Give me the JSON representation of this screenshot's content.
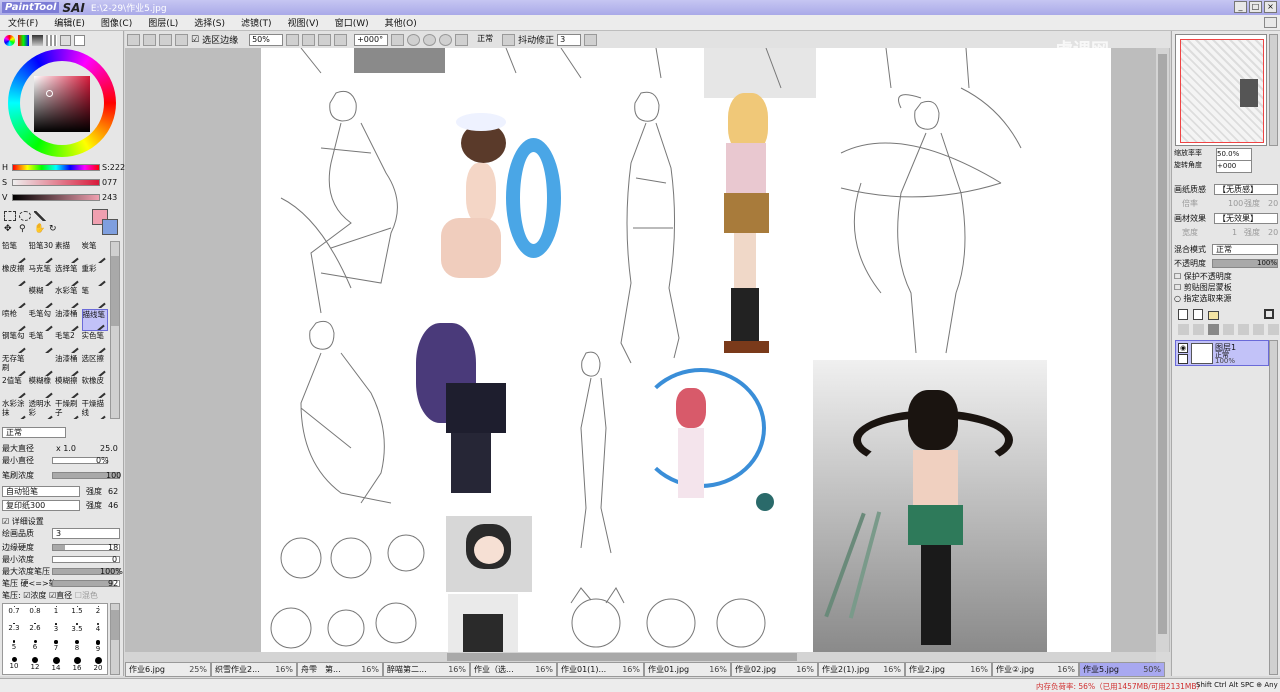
{
  "titlebar": {
    "logo": "PaintTool",
    "logo_sai": "SAI",
    "path": "E:\\2-29\\作业5.jpg",
    "min": "_",
    "max": "□",
    "close": "×"
  },
  "menu": [
    "文件(F)",
    "编辑(E)",
    "图像(C)",
    "图层(L)",
    "选择(S)",
    "滤镜(T)",
    "视图(V)",
    "窗口(W)",
    "其他(O)"
  ],
  "toolbar": {
    "selection_edge_label": "选区边缘",
    "zoom": "50%",
    "angle": "+000°",
    "blend": "正常",
    "stabilizer_label": "抖动修正",
    "stabilizer": "3"
  },
  "watermark": "虎课网",
  "color": {
    "h_label": "H",
    "h_value": "S:222",
    "s_label": "S",
    "s_value": "077",
    "v_label": "V",
    "v_value": "243",
    "primary": "#f0a0b0",
    "secondary": "#7f9fdf"
  },
  "tools": [
    {
      "label": "铅笔"
    },
    {
      "label": "铅笔30"
    },
    {
      "label": "素描"
    },
    {
      "label": "炭笔"
    },
    {
      "label": "橡皮擦"
    },
    {
      "label": "马克笔"
    },
    {
      "label": "选择笔"
    },
    {
      "label": "重彩"
    },
    {
      "label": ""
    },
    {
      "label": "模糊"
    },
    {
      "label": "水彩笔"
    },
    {
      "label": "笔"
    },
    {
      "label": "喷枪"
    },
    {
      "label": "毛笔勾"
    },
    {
      "label": "油漆桶"
    },
    {
      "label": "描线笔"
    },
    {
      "label": "钢笔勾"
    },
    {
      "label": "毛笔"
    },
    {
      "label": "毛笔2"
    },
    {
      "label": "实色笔"
    },
    {
      "label": "无存笔刷"
    },
    {
      "label": ""
    },
    {
      "label": "油漆桶"
    },
    {
      "label": "选区擦"
    },
    {
      "label": "2值笔"
    },
    {
      "label": "模糊橡"
    },
    {
      "label": "模糊擦"
    },
    {
      "label": "软橡皮"
    },
    {
      "label": "水彩涂抹"
    },
    {
      "label": "透明水彩"
    },
    {
      "label": "干燥刷子"
    },
    {
      "label": "干燥描线"
    }
  ],
  "brush": {
    "mode": "正常",
    "max_size_label": "最大直径",
    "max_size_mult": "x 1.0",
    "max_size": "25.0",
    "min_size_label": "最小直径",
    "min_size": "0%",
    "density_label": "笔刷浓度",
    "density": "100",
    "shape": "自动铅笔",
    "shape_strength_label": "强度",
    "shape_strength": "62",
    "texture": "复印纸300",
    "texture_strength_label": "强度",
    "texture_strength": "46",
    "detail_label": "详细设置",
    "quality_label": "绘画品质",
    "quality": "3",
    "edge_label": "边缘硬度",
    "edge": "18",
    "min_density_label": "最小浓度",
    "min_density": "0",
    "pressure_label": "最大浓度笔压",
    "pressure": "100%",
    "pressure_hard_label": "笔压 硬<=>软",
    "pressure_hard": "92",
    "pressure_opts_label": "笔压:",
    "opt_density": "浓度",
    "opt_size": "直径",
    "opt_blend": "混色"
  },
  "sizes": [
    "0.7",
    "0.8",
    "1",
    "1.5",
    "2",
    "2.3",
    "2.6",
    "3",
    "3.5",
    "4",
    "5",
    "6",
    "7",
    "8",
    "9",
    "10",
    "12",
    "14",
    "16",
    "20"
  ],
  "right": {
    "zoom_label": "缩放率率",
    "zoom": "50.0%",
    "rotate_label": "旋转角度",
    "rotate": "+000",
    "paper_label": "画纸质感",
    "paper": "【无质感】",
    "paper_scale": "倍率",
    "paper_scale_v": "100",
    "paper_strength": "强度",
    "paper_strength_v": "20",
    "effect_label": "画材效果",
    "effect": "【无效果】",
    "effect_width": "宽度",
    "effect_width_v": "1",
    "effect_strength": "强度",
    "effect_strength_v": "20",
    "blend_label": "混合模式",
    "blend": "正常",
    "opacity_label": "不透明度",
    "opacity": "100%",
    "opt1": "保护不透明度",
    "opt2": "剪贴图层蒙板",
    "opt3": "指定选取来源",
    "layer_name": "图层1",
    "layer_mode": "正常",
    "layer_opacity": "100%"
  },
  "tabs": [
    {
      "name": "作业6.jpg",
      "pct": "25%"
    },
    {
      "name": "织雪作业2...",
      "pct": "16%"
    },
    {
      "name": "舟雫　第...",
      "pct": "16%"
    },
    {
      "name": "醉喵第二...",
      "pct": "16%"
    },
    {
      "name": "作业（选...",
      "pct": "16%"
    },
    {
      "name": "作业01(1)...",
      "pct": "16%"
    },
    {
      "name": "作业01.jpg",
      "pct": "16%"
    },
    {
      "name": "作业02.jpg",
      "pct": "16%"
    },
    {
      "name": "作业2(1).jpg",
      "pct": "16%"
    },
    {
      "name": "作业2.jpg",
      "pct": "16%"
    },
    {
      "name": "作业②.jpg",
      "pct": "16%"
    },
    {
      "name": "作业5.jpg",
      "pct": "50%"
    }
  ],
  "status": {
    "memory": "内存负荷率: 56%（已用1457MB/可用2131MB）",
    "keys": "Shift Ctrl Alt SPC ⊕ Any"
  }
}
